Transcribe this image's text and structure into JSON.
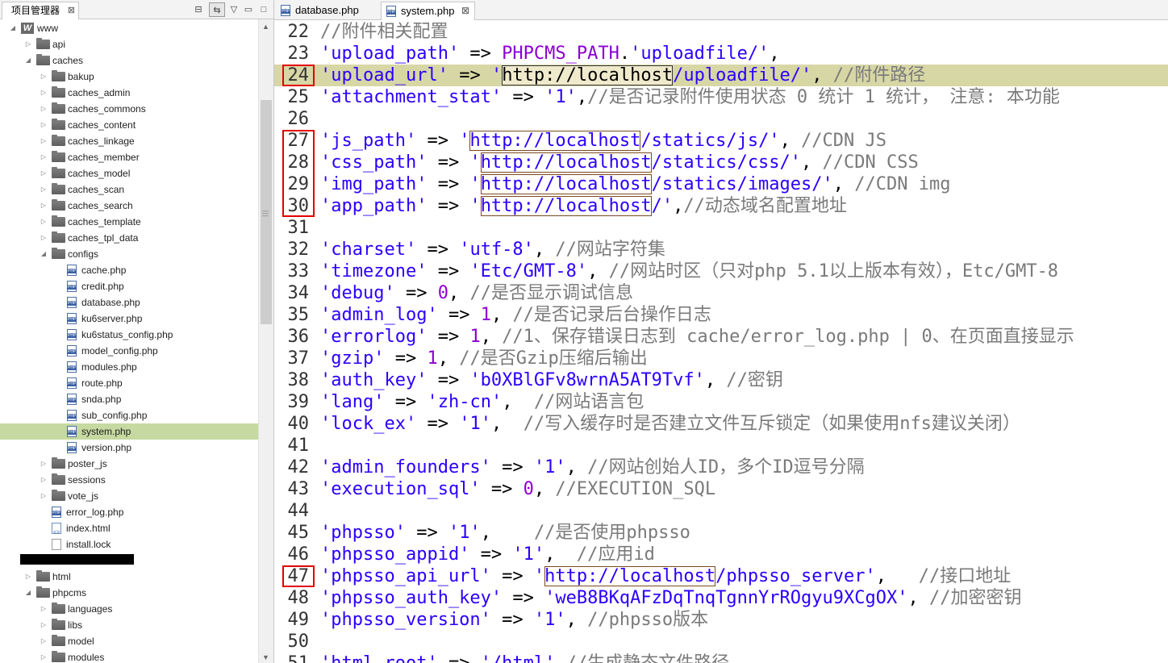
{
  "left_panel": {
    "tab_title": "项目管理器",
    "tab_close": "⊠",
    "toolbar": {
      "collapse": "⊟",
      "link": "⇆",
      "menu": "▽",
      "minimize": "▭",
      "maximize": "□"
    },
    "tree": [
      {
        "label": "www",
        "type": "project",
        "level": 0,
        "expanded": true
      },
      {
        "label": "api",
        "type": "folder",
        "level": 1,
        "expanded": false
      },
      {
        "label": "caches",
        "type": "folder",
        "level": 1,
        "expanded": true
      },
      {
        "label": "bakup",
        "type": "folder",
        "level": 2,
        "expanded": false
      },
      {
        "label": "caches_admin",
        "type": "folder",
        "level": 2,
        "expanded": false
      },
      {
        "label": "caches_commons",
        "type": "folder",
        "level": 2,
        "expanded": false
      },
      {
        "label": "caches_content",
        "type": "folder",
        "level": 2,
        "expanded": false
      },
      {
        "label": "caches_linkage",
        "type": "folder",
        "level": 2,
        "expanded": false
      },
      {
        "label": "caches_member",
        "type": "folder",
        "level": 2,
        "expanded": false
      },
      {
        "label": "caches_model",
        "type": "folder",
        "level": 2,
        "expanded": false
      },
      {
        "label": "caches_scan",
        "type": "folder",
        "level": 2,
        "expanded": false
      },
      {
        "label": "caches_search",
        "type": "folder",
        "level": 2,
        "expanded": false
      },
      {
        "label": "caches_template",
        "type": "folder",
        "level": 2,
        "expanded": false
      },
      {
        "label": "caches_tpl_data",
        "type": "folder",
        "level": 2,
        "expanded": false
      },
      {
        "label": "configs",
        "type": "folder",
        "level": 2,
        "expanded": true
      },
      {
        "label": "cache.php",
        "type": "php",
        "level": 3
      },
      {
        "label": "credit.php",
        "type": "php",
        "level": 3
      },
      {
        "label": "database.php",
        "type": "php",
        "level": 3
      },
      {
        "label": "ku6server.php",
        "type": "php",
        "level": 3
      },
      {
        "label": "ku6status_config.php",
        "type": "php",
        "level": 3
      },
      {
        "label": "model_config.php",
        "type": "php",
        "level": 3
      },
      {
        "label": "modules.php",
        "type": "php",
        "level": 3
      },
      {
        "label": "route.php",
        "type": "php",
        "level": 3
      },
      {
        "label": "snda.php",
        "type": "php",
        "level": 3
      },
      {
        "label": "sub_config.php",
        "type": "php",
        "level": 3
      },
      {
        "label": "system.php",
        "type": "php",
        "level": 3,
        "selected": true
      },
      {
        "label": "version.php",
        "type": "php",
        "level": 3
      },
      {
        "label": "poster_js",
        "type": "folder",
        "level": 2
      },
      {
        "label": "sessions",
        "type": "folder",
        "level": 2
      },
      {
        "label": "vote_js",
        "type": "folder",
        "level": 2
      },
      {
        "label": "error_log.php",
        "type": "php",
        "level": 2
      },
      {
        "label": "index.html",
        "type": "html",
        "level": 2
      },
      {
        "label": "install.lock",
        "type": "txt",
        "level": 2
      },
      {
        "label": "",
        "type": "redacted",
        "level": 1
      },
      {
        "label": "html",
        "type": "folder",
        "level": 1,
        "expanded": false
      },
      {
        "label": "phpcms",
        "type": "folder",
        "level": 1,
        "expanded": true
      },
      {
        "label": "languages",
        "type": "folder",
        "level": 2,
        "expanded": false
      },
      {
        "label": "libs",
        "type": "folder",
        "level": 2,
        "expanded": false
      },
      {
        "label": "model",
        "type": "folder",
        "level": 2,
        "expanded": false
      },
      {
        "label": "modules",
        "type": "folder",
        "level": 2,
        "expanded": false
      }
    ]
  },
  "editor": {
    "tabs": [
      {
        "label": "database.php",
        "active": false
      },
      {
        "label": "system.php",
        "active": true
      }
    ],
    "close_glyph": "⊠",
    "highlighted_line": 24,
    "boxed_lines": [
      24,
      27,
      28,
      29,
      30,
      47
    ],
    "lines": [
      {
        "n": "22",
        "parts": [
          [
            "c",
            "//附件相关配置"
          ]
        ]
      },
      {
        "n": "23",
        "parts": [
          [
            "s",
            "'upload_path'"
          ],
          [
            "p",
            " => "
          ],
          [
            "k",
            "PHPCMS_PATH"
          ],
          [
            "p",
            "."
          ],
          [
            "s",
            "'uploadfile/'"
          ],
          [
            "p",
            ","
          ]
        ]
      },
      {
        "n": "24",
        "parts": [
          [
            "s",
            "'upload_url'"
          ],
          [
            "p",
            " => "
          ],
          [
            "s",
            "'"
          ],
          [
            "hl",
            "http://localhost"
          ],
          [
            "s",
            "/uploadfile/'"
          ],
          [
            "p",
            ", "
          ],
          [
            "c",
            "//附件路径"
          ]
        ]
      },
      {
        "n": "25",
        "parts": [
          [
            "s",
            "'attachment_stat'"
          ],
          [
            "p",
            " => "
          ],
          [
            "s",
            "'1'"
          ],
          [
            "p",
            ","
          ],
          [
            "c",
            "//是否记录附件使用状态 0 统计 1 统计， 注意: 本功能"
          ]
        ]
      },
      {
        "n": "26",
        "parts": []
      },
      {
        "n": "27",
        "parts": [
          [
            "s",
            "'js_path'"
          ],
          [
            "p",
            " => "
          ],
          [
            "s",
            "'"
          ],
          [
            "u",
            "http://localhost"
          ],
          [
            "s",
            "/statics/js/'"
          ],
          [
            "p",
            ", "
          ],
          [
            "c",
            "//CDN JS"
          ]
        ]
      },
      {
        "n": "28",
        "parts": [
          [
            "s",
            "'css_path'"
          ],
          [
            "p",
            " => "
          ],
          [
            "s",
            "'"
          ],
          [
            "u",
            "http://localhost"
          ],
          [
            "s",
            "/statics/css/'"
          ],
          [
            "p",
            ", "
          ],
          [
            "c",
            "//CDN CSS"
          ]
        ]
      },
      {
        "n": "29",
        "parts": [
          [
            "s",
            "'img_path'"
          ],
          [
            "p",
            " => "
          ],
          [
            "s",
            "'"
          ],
          [
            "u",
            "http://localhost"
          ],
          [
            "s",
            "/statics/images/'"
          ],
          [
            "p",
            ", "
          ],
          [
            "c",
            "//CDN img"
          ]
        ]
      },
      {
        "n": "30",
        "parts": [
          [
            "s",
            "'app_path'"
          ],
          [
            "p",
            " => "
          ],
          [
            "s",
            "'"
          ],
          [
            "u",
            "http://localhost"
          ],
          [
            "s",
            "/'"
          ],
          [
            "p",
            ","
          ],
          [
            "c",
            "//动态域名配置地址"
          ]
        ]
      },
      {
        "n": "31",
        "parts": []
      },
      {
        "n": "32",
        "parts": [
          [
            "s",
            "'charset'"
          ],
          [
            "p",
            " => "
          ],
          [
            "s",
            "'utf-8'"
          ],
          [
            "p",
            ", "
          ],
          [
            "c",
            "//网站字符集"
          ]
        ]
      },
      {
        "n": "33",
        "parts": [
          [
            "s",
            "'timezone'"
          ],
          [
            "p",
            " => "
          ],
          [
            "s",
            "'Etc/GMT-8'"
          ],
          [
            "p",
            ", "
          ],
          [
            "c",
            "//网站时区（只对php 5.1以上版本有效），Etc/GMT-8"
          ]
        ]
      },
      {
        "n": "34",
        "parts": [
          [
            "s",
            "'debug'"
          ],
          [
            "p",
            " => "
          ],
          [
            "n",
            "0"
          ],
          [
            "p",
            ", "
          ],
          [
            "c",
            "//是否显示调试信息"
          ]
        ]
      },
      {
        "n": "35",
        "parts": [
          [
            "s",
            "'admin_log'"
          ],
          [
            "p",
            " => "
          ],
          [
            "n",
            "1"
          ],
          [
            "p",
            ", "
          ],
          [
            "c",
            "//是否记录后台操作日志"
          ]
        ]
      },
      {
        "n": "36",
        "parts": [
          [
            "s",
            "'errorlog'"
          ],
          [
            "p",
            " => "
          ],
          [
            "n",
            "1"
          ],
          [
            "p",
            ", "
          ],
          [
            "c",
            "//1、保存错误日志到 cache/error_log.php | 0、在页面直接显示"
          ]
        ]
      },
      {
        "n": "37",
        "parts": [
          [
            "s",
            "'gzip'"
          ],
          [
            "p",
            " => "
          ],
          [
            "n",
            "1"
          ],
          [
            "p",
            ", "
          ],
          [
            "c",
            "//是否Gzip压缩后输出"
          ]
        ]
      },
      {
        "n": "38",
        "parts": [
          [
            "s",
            "'auth_key'"
          ],
          [
            "p",
            " => "
          ],
          [
            "s",
            "'b0XBlGFv8wrnA5AT9Tvf'"
          ],
          [
            "p",
            ", "
          ],
          [
            "c",
            "//密钥"
          ]
        ]
      },
      {
        "n": "39",
        "parts": [
          [
            "s",
            "'lang'"
          ],
          [
            "p",
            " => "
          ],
          [
            "s",
            "'zh-cn'"
          ],
          [
            "p",
            ",  "
          ],
          [
            "c",
            "//网站语言包"
          ]
        ]
      },
      {
        "n": "40",
        "parts": [
          [
            "s",
            "'lock_ex'"
          ],
          [
            "p",
            " => "
          ],
          [
            "s",
            "'1'"
          ],
          [
            "p",
            ",  "
          ],
          [
            "c",
            "//写入缓存时是否建立文件互斥锁定（如果使用nfs建议关闭）"
          ]
        ]
      },
      {
        "n": "41",
        "parts": []
      },
      {
        "n": "42",
        "parts": [
          [
            "s",
            "'admin_founders'"
          ],
          [
            "p",
            " => "
          ],
          [
            "s",
            "'1'"
          ],
          [
            "p",
            ", "
          ],
          [
            "c",
            "//网站创始人ID，多个ID逗号分隔"
          ]
        ]
      },
      {
        "n": "43",
        "parts": [
          [
            "s",
            "'execution_sql'"
          ],
          [
            "p",
            " => "
          ],
          [
            "n",
            "0"
          ],
          [
            "p",
            ", "
          ],
          [
            "c",
            "//EXECUTION_SQL"
          ]
        ]
      },
      {
        "n": "44",
        "parts": []
      },
      {
        "n": "45",
        "parts": [
          [
            "s",
            "'phpsso'"
          ],
          [
            "p",
            " => "
          ],
          [
            "s",
            "'1'"
          ],
          [
            "p",
            ",    "
          ],
          [
            "c",
            "//是否使用phpsso"
          ]
        ]
      },
      {
        "n": "46",
        "parts": [
          [
            "s",
            "'phpsso_appid'"
          ],
          [
            "p",
            " => "
          ],
          [
            "s",
            "'1'"
          ],
          [
            "p",
            ",  "
          ],
          [
            "c",
            "//应用id"
          ]
        ]
      },
      {
        "n": "47",
        "parts": [
          [
            "s",
            "'"
          ],
          [
            "u",
            "http://localhost"
          ],
          [
            "s",
            "/phpsso_server'"
          ],
          [
            "p",
            ",   "
          ],
          [
            "c",
            "//接口地址"
          ]
        ],
        "prefix": [
          [
            "s",
            "'phpsso_api_url'"
          ],
          [
            "p",
            " => "
          ]
        ]
      },
      {
        "n": "48",
        "parts": [
          [
            "s",
            "'phpsso_auth_key'"
          ],
          [
            "p",
            " => "
          ],
          [
            "s",
            "'weB8BKqAFzDqTnqTgnnYrROgyu9XCgOX'"
          ],
          [
            "p",
            ", "
          ],
          [
            "c",
            "//加密密钥"
          ]
        ]
      },
      {
        "n": "49",
        "parts": [
          [
            "s",
            "'phpsso_version'"
          ],
          [
            "p",
            " => "
          ],
          [
            "s",
            "'1'"
          ],
          [
            "p",
            ", "
          ],
          [
            "c",
            "//phpsso版本"
          ]
        ]
      },
      {
        "n": "50",
        "parts": []
      },
      {
        "n": "51",
        "parts": [
          [
            "s",
            "'html_root'"
          ],
          [
            "p",
            " => "
          ],
          [
            "s",
            "'/html'"
          ],
          [
            "p",
            ","
          ],
          [
            "c",
            "//生成静态文件路径"
          ]
        ]
      }
    ]
  }
}
